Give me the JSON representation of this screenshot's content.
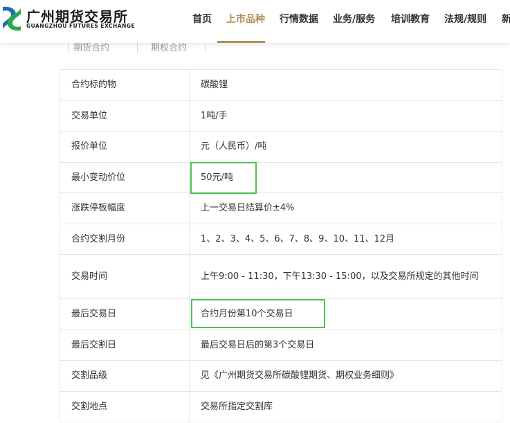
{
  "header": {
    "logo_cn": "广州期货交易所",
    "logo_en": "GUANGZHOU FUTURES EXCHANGE",
    "nav": [
      {
        "label": "首页",
        "active": false
      },
      {
        "label": "上市品种",
        "active": true
      },
      {
        "label": "行情数据",
        "active": false
      },
      {
        "label": "业务/服务",
        "active": false
      },
      {
        "label": "培训教育",
        "active": false
      },
      {
        "label": "法规/规则",
        "active": false
      },
      {
        "label": "新",
        "active": false
      }
    ]
  },
  "subtabs": [
    "期货合约",
    "期权合约"
  ],
  "contract_table": [
    {
      "label": "合约标的物",
      "value": "碳酸锂"
    },
    {
      "label": "交易单位",
      "value": "1吨/手"
    },
    {
      "label": "报价单位",
      "value": "元（人民币）/吨"
    },
    {
      "label": "最小变动价位",
      "value": "50元/吨"
    },
    {
      "label": "涨跌停板幅度",
      "value": "上一交易日结算价±4%"
    },
    {
      "label": "合约交割月份",
      "value": "1、2、3、4、5、6、7、8、9、10、11、12月"
    },
    {
      "label": "交易时间",
      "value": "上午9:00 - 11:30，下午13:30 - 15:00，以及交易所规定的其他时间"
    },
    {
      "label": "最后交易日",
      "value": "合约月份第10个交易日"
    },
    {
      "label": "最后交割日",
      "value": "最后交易日后的第3个交易日"
    },
    {
      "label": "交割品级",
      "value": "见《广州期货交易所碳酸锂期货、期权业务细则》"
    },
    {
      "label": "交割地点",
      "value": "交易所指定交割库"
    }
  ],
  "colors": {
    "accent": "#b08d57",
    "highlight": "#4cc24c",
    "logo_blue": "#1f6fb5",
    "logo_green": "#2aa84a"
  }
}
